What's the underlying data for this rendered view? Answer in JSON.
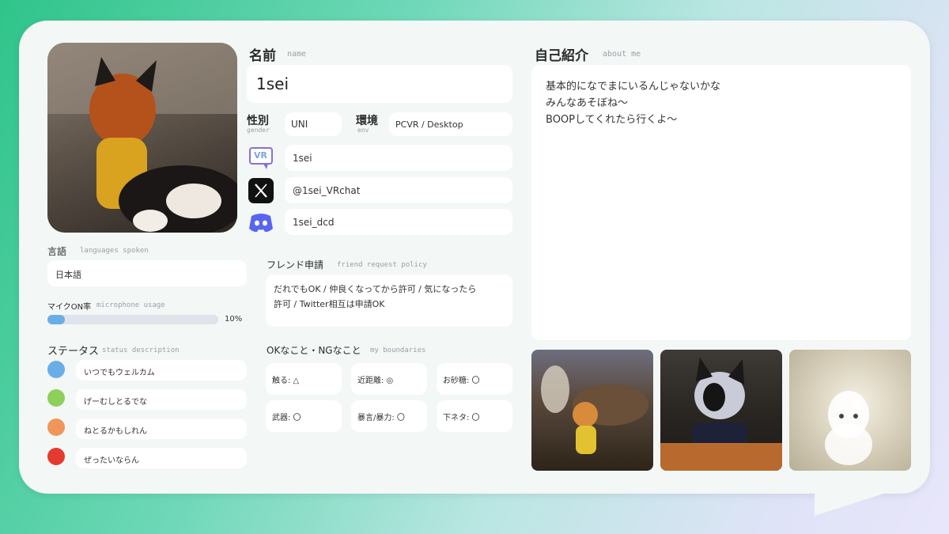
{
  "card": {
    "name_label": "名前",
    "name_label_en": "name",
    "name_value": "1sei",
    "gender_label": "性別",
    "gender_label_en": "gender",
    "gender_value": "UNI",
    "env_label": "環境",
    "env_label_en": "env",
    "env_value": "PCVR / Desktop",
    "vrchat_handle": "1sei",
    "x_handle": "@1sei_VRchat",
    "discord_handle": "1sei_dcd",
    "vr_icon_text": "VR"
  },
  "languages": {
    "label": "言語",
    "label_en": "languages spoken",
    "value": "日本語"
  },
  "mic": {
    "label": "マイクON率",
    "label_en": "microphone usage",
    "percent_text": "10%",
    "fill_percent": 10
  },
  "status": {
    "label": "ステータス",
    "label_en": "status description",
    "items": [
      {
        "color": "#6aaee8",
        "text": "いつでもウェルカム"
      },
      {
        "color": "#8ed05a",
        "text": "げーむしとるでな"
      },
      {
        "color": "#f0965a",
        "text": "ねとるかもしれん"
      },
      {
        "color": "#e63a2e",
        "text": "ぜったいならん"
      }
    ]
  },
  "friend": {
    "label": "フレンド申請",
    "label_en": "friend request policy",
    "line1": "だれでもOK / 仲良くなってから許可 / 気になったら",
    "line2": "許可 / Twitter相互は申請OK"
  },
  "boundaries": {
    "label": "OKなこと・NGなこと",
    "label_en": "my boundaries",
    "items": [
      "触る: △",
      "近距離: ◎",
      "お砂糖: 〇",
      "武器: 〇",
      "暴言/暴力: 〇",
      "下ネタ: 〇"
    ]
  },
  "about": {
    "label": "自己紹介",
    "label_en": "about me",
    "lines": [
      "基本的になでまにいるんじゃないかな",
      "みんなあそぼね～",
      "BOOPしてくれたら行くよ～"
    ]
  },
  "colors": {
    "accent_blue": "#6aaee8",
    "x_black": "#111111",
    "discord": "#5865f2",
    "vr_purple": "#8a6fd8"
  }
}
